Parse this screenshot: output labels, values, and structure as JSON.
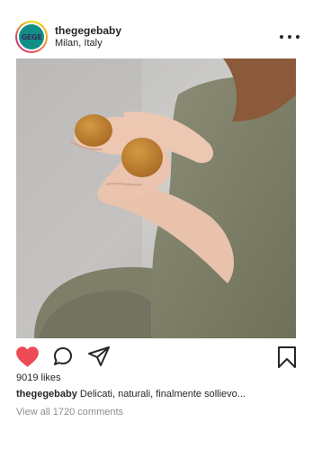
{
  "post": {
    "username": "thegegebaby",
    "location": "Milan, Italy",
    "avatar_text": "GEGE",
    "likes": "9019 likes",
    "caption_user": "thegegebaby",
    "caption_text": "Delicati, naturali, finalmente sollievo...",
    "comments_link": "View all 1720 comments"
  },
  "icons": {
    "more": "more-options-icon",
    "like": "heart-icon",
    "comment": "comment-icon",
    "share": "send-icon",
    "save": "bookmark-icon"
  },
  "colors": {
    "like_active": "#ed4956",
    "text": "#262626",
    "muted": "#8e8e8e",
    "avatar_bg": "#0f8f86"
  }
}
